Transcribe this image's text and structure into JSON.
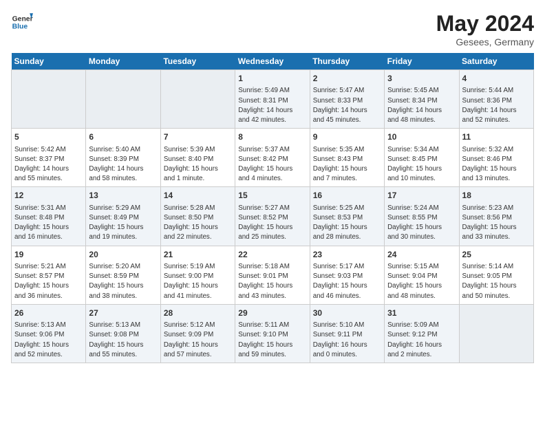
{
  "header": {
    "logo_line1": "General",
    "logo_line2": "Blue",
    "month": "May 2024",
    "location": "Gesees, Germany"
  },
  "weekdays": [
    "Sunday",
    "Monday",
    "Tuesday",
    "Wednesday",
    "Thursday",
    "Friday",
    "Saturday"
  ],
  "weeks": [
    [
      {
        "day": "",
        "info": ""
      },
      {
        "day": "",
        "info": ""
      },
      {
        "day": "",
        "info": ""
      },
      {
        "day": "1",
        "info": "Sunrise: 5:49 AM\nSunset: 8:31 PM\nDaylight: 14 hours\nand 42 minutes."
      },
      {
        "day": "2",
        "info": "Sunrise: 5:47 AM\nSunset: 8:33 PM\nDaylight: 14 hours\nand 45 minutes."
      },
      {
        "day": "3",
        "info": "Sunrise: 5:45 AM\nSunset: 8:34 PM\nDaylight: 14 hours\nand 48 minutes."
      },
      {
        "day": "4",
        "info": "Sunrise: 5:44 AM\nSunset: 8:36 PM\nDaylight: 14 hours\nand 52 minutes."
      }
    ],
    [
      {
        "day": "5",
        "info": "Sunrise: 5:42 AM\nSunset: 8:37 PM\nDaylight: 14 hours\nand 55 minutes."
      },
      {
        "day": "6",
        "info": "Sunrise: 5:40 AM\nSunset: 8:39 PM\nDaylight: 14 hours\nand 58 minutes."
      },
      {
        "day": "7",
        "info": "Sunrise: 5:39 AM\nSunset: 8:40 PM\nDaylight: 15 hours\nand 1 minute."
      },
      {
        "day": "8",
        "info": "Sunrise: 5:37 AM\nSunset: 8:42 PM\nDaylight: 15 hours\nand 4 minutes."
      },
      {
        "day": "9",
        "info": "Sunrise: 5:35 AM\nSunset: 8:43 PM\nDaylight: 15 hours\nand 7 minutes."
      },
      {
        "day": "10",
        "info": "Sunrise: 5:34 AM\nSunset: 8:45 PM\nDaylight: 15 hours\nand 10 minutes."
      },
      {
        "day": "11",
        "info": "Sunrise: 5:32 AM\nSunset: 8:46 PM\nDaylight: 15 hours\nand 13 minutes."
      }
    ],
    [
      {
        "day": "12",
        "info": "Sunrise: 5:31 AM\nSunset: 8:48 PM\nDaylight: 15 hours\nand 16 minutes."
      },
      {
        "day": "13",
        "info": "Sunrise: 5:29 AM\nSunset: 8:49 PM\nDaylight: 15 hours\nand 19 minutes."
      },
      {
        "day": "14",
        "info": "Sunrise: 5:28 AM\nSunset: 8:50 PM\nDaylight: 15 hours\nand 22 minutes."
      },
      {
        "day": "15",
        "info": "Sunrise: 5:27 AM\nSunset: 8:52 PM\nDaylight: 15 hours\nand 25 minutes."
      },
      {
        "day": "16",
        "info": "Sunrise: 5:25 AM\nSunset: 8:53 PM\nDaylight: 15 hours\nand 28 minutes."
      },
      {
        "day": "17",
        "info": "Sunrise: 5:24 AM\nSunset: 8:55 PM\nDaylight: 15 hours\nand 30 minutes."
      },
      {
        "day": "18",
        "info": "Sunrise: 5:23 AM\nSunset: 8:56 PM\nDaylight: 15 hours\nand 33 minutes."
      }
    ],
    [
      {
        "day": "19",
        "info": "Sunrise: 5:21 AM\nSunset: 8:57 PM\nDaylight: 15 hours\nand 36 minutes."
      },
      {
        "day": "20",
        "info": "Sunrise: 5:20 AM\nSunset: 8:59 PM\nDaylight: 15 hours\nand 38 minutes."
      },
      {
        "day": "21",
        "info": "Sunrise: 5:19 AM\nSunset: 9:00 PM\nDaylight: 15 hours\nand 41 minutes."
      },
      {
        "day": "22",
        "info": "Sunrise: 5:18 AM\nSunset: 9:01 PM\nDaylight: 15 hours\nand 43 minutes."
      },
      {
        "day": "23",
        "info": "Sunrise: 5:17 AM\nSunset: 9:03 PM\nDaylight: 15 hours\nand 46 minutes."
      },
      {
        "day": "24",
        "info": "Sunrise: 5:15 AM\nSunset: 9:04 PM\nDaylight: 15 hours\nand 48 minutes."
      },
      {
        "day": "25",
        "info": "Sunrise: 5:14 AM\nSunset: 9:05 PM\nDaylight: 15 hours\nand 50 minutes."
      }
    ],
    [
      {
        "day": "26",
        "info": "Sunrise: 5:13 AM\nSunset: 9:06 PM\nDaylight: 15 hours\nand 52 minutes."
      },
      {
        "day": "27",
        "info": "Sunrise: 5:13 AM\nSunset: 9:08 PM\nDaylight: 15 hours\nand 55 minutes."
      },
      {
        "day": "28",
        "info": "Sunrise: 5:12 AM\nSunset: 9:09 PM\nDaylight: 15 hours\nand 57 minutes."
      },
      {
        "day": "29",
        "info": "Sunrise: 5:11 AM\nSunset: 9:10 PM\nDaylight: 15 hours\nand 59 minutes."
      },
      {
        "day": "30",
        "info": "Sunrise: 5:10 AM\nSunset: 9:11 PM\nDaylight: 16 hours\nand 0 minutes."
      },
      {
        "day": "31",
        "info": "Sunrise: 5:09 AM\nSunset: 9:12 PM\nDaylight: 16 hours\nand 2 minutes."
      },
      {
        "day": "",
        "info": ""
      }
    ]
  ]
}
